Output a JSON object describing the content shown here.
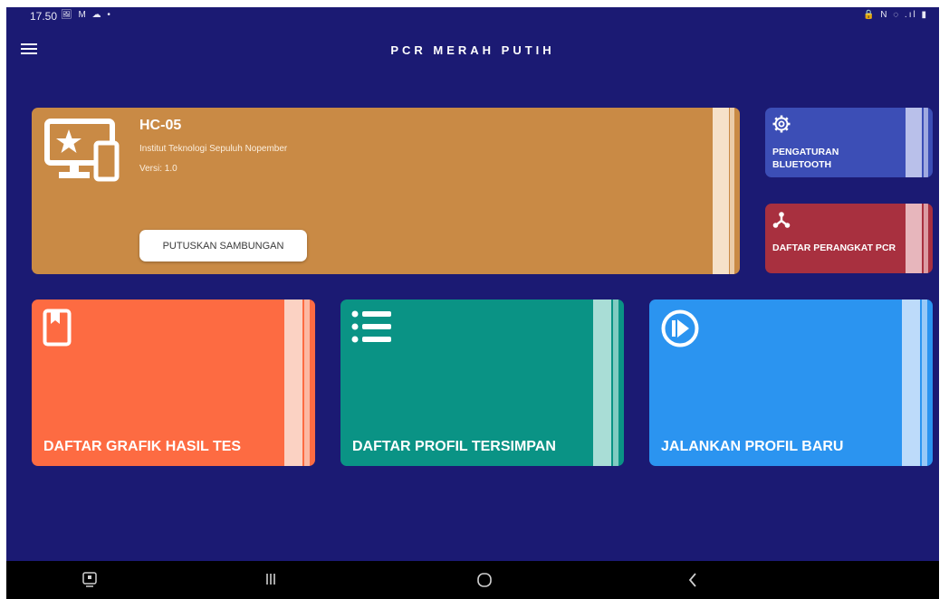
{
  "status_bar": {
    "time": "17.50",
    "left_icons": "🖼 M ☁ •",
    "right_icons": "🔒 N ◌ .ıl ▮"
  },
  "app_bar": {
    "title": "PCR MERAH PUTIH",
    "menu_icon": "hamburger-icon"
  },
  "device_card": {
    "name": "HC-05",
    "organization": "Institut Teknologi Sepuluh Nopember",
    "version": "Versi: 1.0",
    "disconnect_label": "PUTUSKAN SAMBUNGAN",
    "icon": "devices-star-icon",
    "color": "#c98a45"
  },
  "side_cards": [
    {
      "label": "PENGATURAN BLUETOOTH",
      "icon": "gear-icon",
      "color": "#3c4eb6"
    },
    {
      "label": "DAFTAR PERANGKAT PCR",
      "icon": "branch-icon",
      "color": "#a8303f"
    }
  ],
  "main_cards": [
    {
      "label": "DAFTAR GRAFIK HASIL TES",
      "icon": "bookmark-book-icon",
      "color": "#fd6b42"
    },
    {
      "label": "DAFTAR PROFIL TERSIMPAN",
      "icon": "list-icon",
      "color": "#0a9385"
    },
    {
      "label": "JALANKAN PROFIL BARU",
      "icon": "play-circle-icon",
      "color": "#2b94f0"
    }
  ],
  "nav_bar": {
    "icons": [
      "screenshot-icon",
      "recents-icon",
      "home-icon",
      "back-icon"
    ]
  }
}
